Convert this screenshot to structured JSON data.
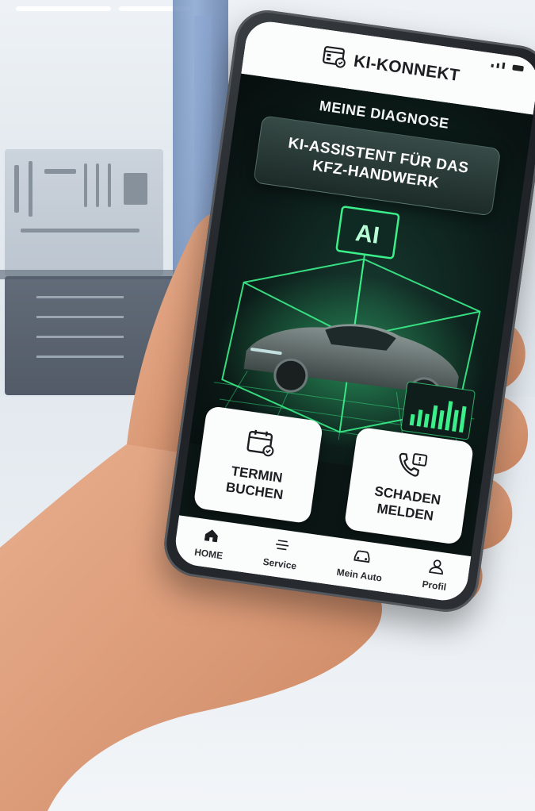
{
  "app": {
    "title": "KI-KONNEKT",
    "logo_icon": "calendar-diagnostic-icon"
  },
  "hero": {
    "heading": "MEINE DIAGNOSE",
    "assistant_line1": "KI-ASSISTENT FÜR DAS",
    "assistant_line2": "KFZ-HANDWERK",
    "ai_label": "AI",
    "accent_color": "#3bf08a"
  },
  "actions": [
    {
      "line1": "TERMIN",
      "line2": "BUCHEN",
      "icon": "calendar-icon"
    },
    {
      "line1": "SCHADEN",
      "line2": "MELDEN",
      "icon": "phone-report-icon"
    }
  ],
  "nav": [
    {
      "label": "HOME",
      "icon": "home-icon",
      "active": true
    },
    {
      "label": "Service",
      "icon": "service-icon",
      "active": false
    },
    {
      "label": "Mein Auto",
      "icon": "car-icon",
      "active": false
    },
    {
      "label": "Profil",
      "icon": "user-icon",
      "active": false
    }
  ]
}
